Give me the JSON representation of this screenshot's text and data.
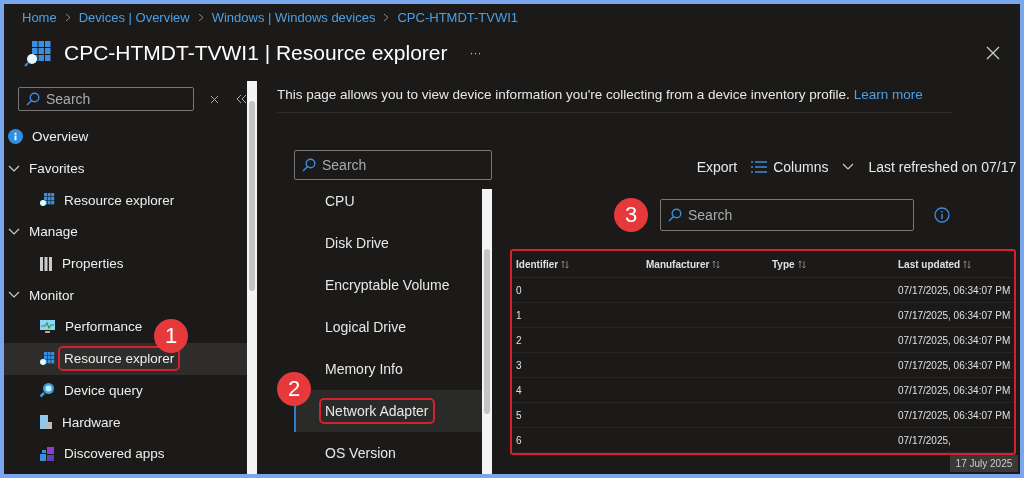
{
  "breadcrumb": [
    "Home",
    "Devices | Overview",
    "Windows | Windows devices",
    "CPC-HTMDT-TVWI1"
  ],
  "title": "CPC-HTMDT-TVWI1 | Resource explorer",
  "more": "···",
  "sidebar": {
    "search": {
      "placeholder": "Search"
    },
    "items": [
      {
        "kind": "link",
        "label": "Overview",
        "selected": false
      },
      {
        "kind": "group",
        "label": "Favorites",
        "expanded": true,
        "children": [
          {
            "kind": "link",
            "label": "Resource explorer",
            "selected": false
          }
        ]
      },
      {
        "kind": "group",
        "label": "Manage",
        "expanded": true,
        "children": [
          {
            "kind": "link",
            "label": "Properties",
            "selected": false
          }
        ]
      },
      {
        "kind": "group",
        "label": "Monitor",
        "expanded": true,
        "children": [
          {
            "kind": "link",
            "label": "Performance",
            "selected": false
          },
          {
            "kind": "link",
            "label": "Resource explorer",
            "selected": true,
            "badge": "1"
          },
          {
            "kind": "link",
            "label": "Device query",
            "selected": false
          },
          {
            "kind": "link",
            "label": "Hardware",
            "selected": false
          },
          {
            "kind": "link",
            "label": "Discovered apps",
            "selected": false
          }
        ]
      }
    ]
  },
  "description": {
    "text": "This page allows you to view device information you're collecting from a device inventory profile.",
    "link": "Learn more"
  },
  "categories": {
    "search": {
      "placeholder": "Search"
    },
    "items": [
      {
        "label": "CPU",
        "selected": false
      },
      {
        "label": "Disk Drive",
        "selected": false
      },
      {
        "label": "Encryptable Volume",
        "selected": false
      },
      {
        "label": "Logical Drive",
        "selected": false
      },
      {
        "label": "Memory Info",
        "selected": false
      },
      {
        "label": "Network Adapter",
        "selected": true,
        "badge": "2"
      },
      {
        "label": "OS Version",
        "selected": false
      }
    ]
  },
  "toolbar": {
    "export": "Export",
    "columns": "Columns",
    "refreshed": "Last refreshed on 07/17"
  },
  "table_search": {
    "placeholder": "Search",
    "badge": "3"
  },
  "table": {
    "columns": [
      "Identifier",
      "Manufacturer",
      "Type",
      "Last updated"
    ],
    "rows": [
      [
        "0",
        "",
        "",
        "07/17/2025, 06:34:07 PM"
      ],
      [
        "1",
        "",
        "",
        "07/17/2025, 06:34:07 PM"
      ],
      [
        "2",
        "",
        "",
        "07/17/2025, 06:34:07 PM"
      ],
      [
        "3",
        "",
        "",
        "07/17/2025, 06:34:07 PM"
      ],
      [
        "4",
        "",
        "",
        "07/17/2025, 06:34:07 PM"
      ],
      [
        "5",
        "",
        "",
        "07/17/2025, 06:34:07 PM"
      ],
      [
        "6",
        "",
        "",
        "07/17/2025,"
      ]
    ]
  },
  "tooltip": "17 July 2025"
}
